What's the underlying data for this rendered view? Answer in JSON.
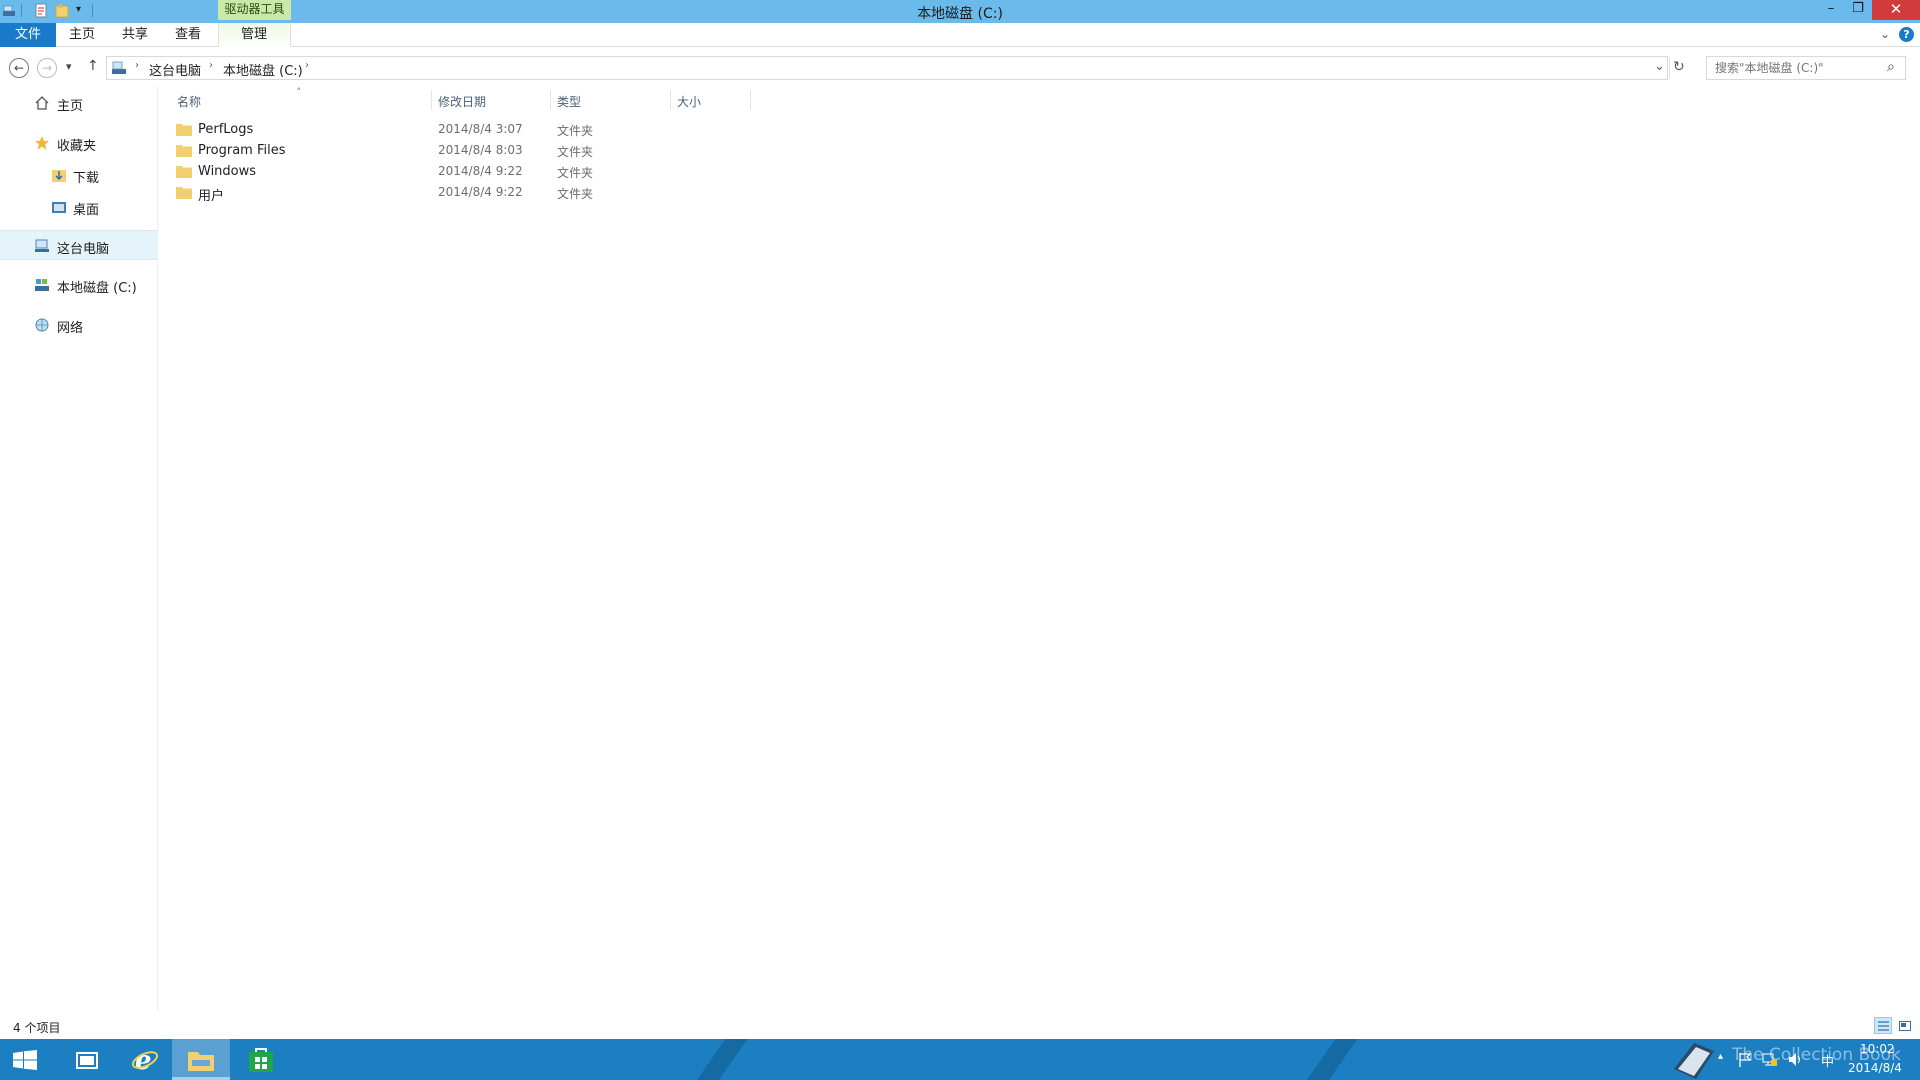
{
  "window": {
    "title": "本地磁盘 (C:)",
    "contextual_tab_header": "驱动器工具",
    "min_glyph": "–",
    "max_glyph": "❐",
    "close_glyph": "✕"
  },
  "ribbon": {
    "tabs": [
      "文件",
      "主页",
      "共享",
      "查看",
      "管理"
    ],
    "collapse_glyph": "⌄",
    "help_glyph": "?"
  },
  "navigation": {
    "back_glyph": "←",
    "forward_glyph": "→",
    "recent_glyph": "▾",
    "up_glyph": "↑"
  },
  "address": {
    "crumbs": [
      "这台电脑",
      "本地磁盘 (C:)"
    ],
    "separator": "›",
    "dropdown_glyph": "⌄",
    "refresh_glyph": "↻"
  },
  "search": {
    "placeholder": "搜索\"本地磁盘 (C:)\"",
    "icon_glyph": "⌕"
  },
  "nav_pane": {
    "items": [
      {
        "label": "主页",
        "icon": "home-icon"
      },
      {
        "label": "收藏夹",
        "icon": "star-icon"
      },
      {
        "label": "下载",
        "icon": "downloads-folder-icon"
      },
      {
        "label": "桌面",
        "icon": "desktop-folder-icon"
      },
      {
        "label": "这台电脑",
        "icon": "computer-icon"
      },
      {
        "label": "本地磁盘 (C:)",
        "icon": "drive-icon"
      },
      {
        "label": "网络",
        "icon": "network-icon"
      }
    ]
  },
  "file_list": {
    "columns": [
      "名称",
      "修改日期",
      "类型",
      "大小"
    ],
    "sort_glyph": "˄",
    "rows": [
      {
        "name": "PerfLogs",
        "date": "2014/8/4 3:07",
        "type": "文件夹"
      },
      {
        "name": "Program Files",
        "date": "2014/8/4 8:03",
        "type": "文件夹"
      },
      {
        "name": "Windows",
        "date": "2014/8/4 9:22",
        "type": "文件夹"
      },
      {
        "name": "用户",
        "date": "2014/8/4 9:22",
        "type": "文件夹"
      }
    ]
  },
  "status": {
    "item_count": "4 个项目"
  },
  "taskbar": {
    "tray_arrow": "▴",
    "ime": "中",
    "time": "10:02",
    "date": "2014/8/4",
    "watermark": "The Collection Book"
  },
  "colors": {
    "titlebar": "#6abbeb",
    "file_tab": "#1979ca",
    "contextual_tab": "#c9e9a8",
    "close_button": "#d13b3b",
    "taskbar": "#1c7fc1",
    "folder": "#f2cf6f"
  }
}
